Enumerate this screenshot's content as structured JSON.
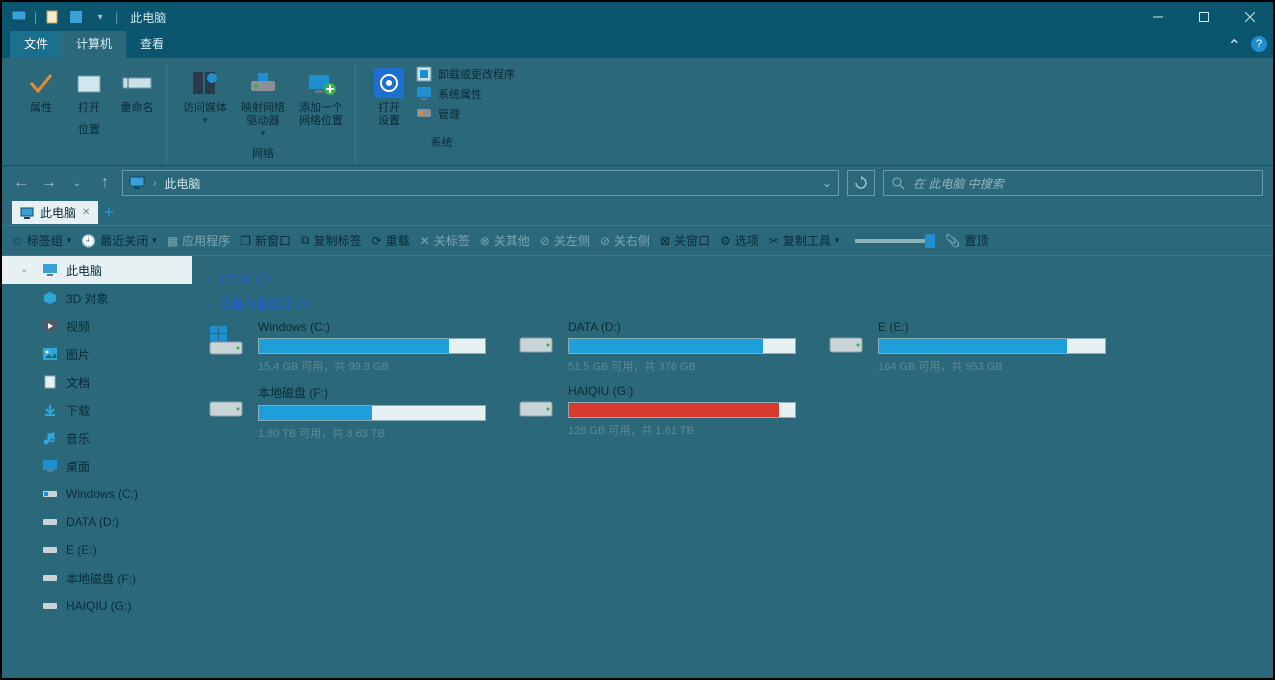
{
  "window": {
    "title": "此电脑"
  },
  "tabs": {
    "file": "文件",
    "computer": "计算机",
    "view": "查看"
  },
  "ribbon": {
    "location": {
      "properties": "属性",
      "open": "打开",
      "rename": "重命名",
      "group_label": "位置"
    },
    "network": {
      "access_media": "访问媒体",
      "map_drive": "映射网络\n驱动器",
      "add_location": "添加一个\n网络位置",
      "group_label": "网络"
    },
    "system": {
      "settings": "打开\n设置",
      "uninstall": "卸载或更改程序",
      "sysprops": "系统属性",
      "manage": "管理",
      "group_label": "系统"
    }
  },
  "address": {
    "location": "此电脑"
  },
  "search": {
    "placeholder": "在 此电脑 中搜索"
  },
  "wtab": {
    "label": "此电脑"
  },
  "toolbar": {
    "tabgroup": "标签组",
    "recent_closed": "最近关闭",
    "apps": "应用程序",
    "new_window": "新窗口",
    "copy_tab": "复制标签",
    "reload": "重载",
    "close_tab": "关标签",
    "close_other": "关其他",
    "close_left": "关左侧",
    "close_right": "关右侧",
    "close_window": "关窗口",
    "options": "选项",
    "copy_tools": "复制工具",
    "pin": "置顶"
  },
  "sidebar": {
    "this_pc": "此电脑",
    "objects3d": "3D 对象",
    "videos": "视频",
    "pictures": "图片",
    "documents": "文档",
    "downloads": "下载",
    "music": "音乐",
    "desktop": "桌面",
    "win_c": "Windows (C:)",
    "data_d": "DATA (D:)",
    "e_e": "E (E:)",
    "local_f": "本地磁盘 (F:)",
    "haiqiu_g": "HAIQIU (G:)"
  },
  "content": {
    "folders_hdr": "文件夹 (7)",
    "devices_hdr": "设备和驱动器 (5)",
    "drives": [
      {
        "label": "Windows (C:)",
        "stat": "15.4 GB 可用，共 99.9 GB",
        "pct": 84,
        "red": false,
        "os": true
      },
      {
        "label": "DATA (D:)",
        "stat": "51.5 GB 可用，共 376 GB",
        "pct": 86,
        "red": false,
        "os": false
      },
      {
        "label": "E (E:)",
        "stat": "164 GB 可用，共 953 GB",
        "pct": 83,
        "red": false,
        "os": false
      },
      {
        "label": "本地磁盘 (F:)",
        "stat": "1.80 TB 可用，共 3.63 TB",
        "pct": 50,
        "red": false,
        "os": false
      },
      {
        "label": "HAIQIU (G:)",
        "stat": "128 GB 可用，共 1.81 TB",
        "pct": 93,
        "red": true,
        "os": false
      }
    ]
  }
}
